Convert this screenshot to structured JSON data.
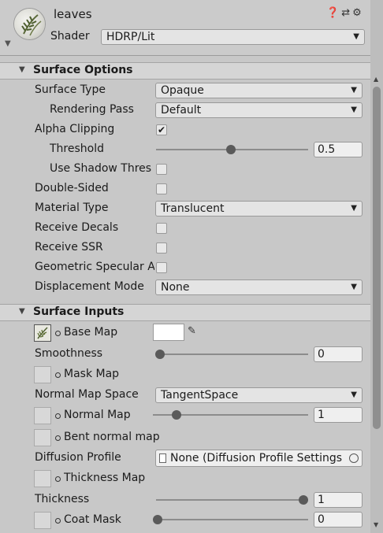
{
  "header": {
    "material_name": "leaves",
    "shader_label": "Shader",
    "shader_value": "HDRP/Lit",
    "icons": [
      "help-icon",
      "preset-icon",
      "gear-icon"
    ]
  },
  "surface_options": {
    "title": "Surface Options",
    "surface_type": {
      "label": "Surface Type",
      "value": "Opaque"
    },
    "rendering_pass": {
      "label": "Rendering Pass",
      "value": "Default"
    },
    "alpha_clipping": {
      "label": "Alpha Clipping",
      "checked": true
    },
    "threshold": {
      "label": "Threshold",
      "value": "0.5",
      "level": 0.5
    },
    "use_shadow_threshold": {
      "label": "Use Shadow Thres",
      "checked": false
    },
    "double_sided": {
      "label": "Double-Sided",
      "checked": false
    },
    "material_type": {
      "label": "Material Type",
      "value": "Translucent"
    },
    "receive_decals": {
      "label": "Receive Decals",
      "checked": false
    },
    "receive_ssr": {
      "label": "Receive SSR",
      "checked": false
    },
    "geometric_specular_aa": {
      "label": "Geometric Specular A",
      "checked": false
    },
    "displacement_mode": {
      "label": "Displacement Mode",
      "value": "None"
    }
  },
  "surface_inputs": {
    "title": "Surface Inputs",
    "base_map": {
      "label": "Base Map",
      "color": "#ffffff"
    },
    "smoothness": {
      "label": "Smoothness",
      "value": "0",
      "level": 0
    },
    "mask_map": {
      "label": "Mask Map"
    },
    "normal_map_space": {
      "label": "Normal Map Space",
      "value": "TangentSpace"
    },
    "normal_map": {
      "label": "Normal Map",
      "value": "1",
      "level": 0.16
    },
    "bent_normal_map": {
      "label": "Bent normal map"
    },
    "diffusion_profile": {
      "label": "Diffusion Profile",
      "value": "None (Diffusion Profile Settings"
    },
    "thickness_map": {
      "label": "Thickness Map"
    },
    "thickness": {
      "label": "Thickness",
      "value": "1",
      "level": 1
    },
    "coat_mask": {
      "label": "Coat Mask",
      "value": "0",
      "level": 0
    }
  }
}
